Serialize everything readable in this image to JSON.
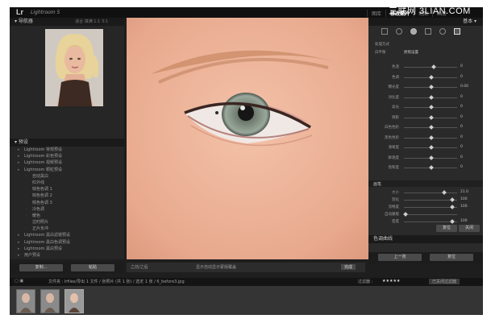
{
  "app": {
    "logo": "Lr",
    "title": "Lightroom 5",
    "watermark": "三联网 3LIAN.COM"
  },
  "modules": [
    "图库",
    "修改照片",
    "地图",
    "画册"
  ],
  "active_module": "修改照片",
  "left_panel": {
    "navigator_title": "导航器",
    "navigator_options": "适合  填满  1:1  3:1",
    "presets_title": "预设",
    "presets": [
      {
        "label": "Lightroom 常规预设",
        "level": 1
      },
      {
        "label": "Lightroom 彩色预设",
        "level": 1
      },
      {
        "label": "Lightroom 视频预设",
        "level": 1
      },
      {
        "label": "Lightroom 颗粒预设",
        "level": 1
      },
      {
        "label": "自动黑白",
        "level": 2
      },
      {
        "label": "红外线",
        "level": 2
      },
      {
        "label": "棕色色调 1",
        "level": 2
      },
      {
        "label": "棕色色调 2",
        "level": 2
      },
      {
        "label": "棕色色调 3",
        "level": 2
      },
      {
        "label": "冷色调",
        "level": 2
      },
      {
        "label": "暖色",
        "level": 2
      },
      {
        "label": "过时照片",
        "level": 2
      },
      {
        "label": "正片负冲",
        "level": 2
      },
      {
        "label": "Lightroom 黑白滤镜预设",
        "level": 1
      },
      {
        "label": "Lightroom 黑白色调预设",
        "level": 1
      },
      {
        "label": "Lightroom 黑白预设",
        "level": 1
      },
      {
        "label": "用户预设",
        "level": 1
      }
    ],
    "copy_button": "复制...",
    "paste_button": "粘贴"
  },
  "toolbar": {
    "label": "之前/之后",
    "status": "显示自动显示蒙版覆盖",
    "done_button": "完成"
  },
  "right_panel": {
    "title": "基本",
    "profile": "处理方式",
    "wb_label": "白平衡",
    "wb_value": "原照设置",
    "sliders": [
      {
        "label": "色温",
        "value": "0",
        "pos": 0.55
      },
      {
        "label": "色调",
        "value": "0",
        "pos": 0.5
      },
      {
        "label": "曝光度",
        "value": "0.00",
        "pos": 0.5
      },
      {
        "label": "对比度",
        "value": "0",
        "pos": 0.5
      },
      {
        "label": "高光",
        "value": "0",
        "pos": 0.5
      },
      {
        "label": "阴影",
        "value": "0",
        "pos": 0.5
      },
      {
        "label": "白色色阶",
        "value": "0",
        "pos": 0.5
      },
      {
        "label": "黑色色阶",
        "value": "0",
        "pos": 0.5
      },
      {
        "label": "清晰度",
        "value": "0",
        "pos": 0.5
      },
      {
        "label": "鲜艳度",
        "value": "0",
        "pos": 0.5
      },
      {
        "label": "饱和度",
        "value": "0",
        "pos": 0.5
      }
    ],
    "brush_section": {
      "title": "画笔",
      "sliders": [
        {
          "label": "大小",
          "value": "21.0",
          "pos": 0.75
        },
        {
          "label": "羽化",
          "value": "100",
          "pos": 0.9
        },
        {
          "label": "流畅度",
          "value": "100",
          "pos": 0.9
        },
        {
          "label": "自动蒙版",
          "value": "",
          "pos": 0.0
        },
        {
          "label": "密度",
          "value": "100",
          "pos": 0.9
        }
      ]
    },
    "reset_button": "复位",
    "close_button": "关闭",
    "tone_curve_title": "色调曲线",
    "prev_button": "上一张",
    "reset_all_button": "复位"
  },
  "filmstrip_bar": {
    "path": "文件夹 : lrfiles/导出 1 文件  / 张照片 (共 1 张) / 选定 1 张 / 6_before3.jpg",
    "filter_label": "过滤器 :",
    "rating": "★★★★★",
    "filter_state": "已关闭过滤器"
  },
  "filmstrip_count": 3
}
